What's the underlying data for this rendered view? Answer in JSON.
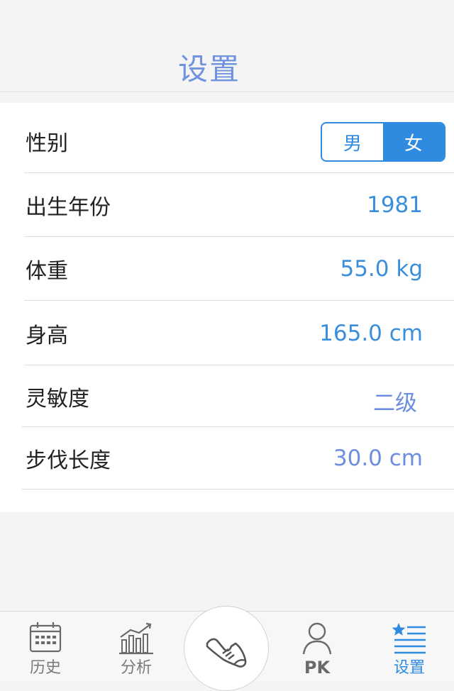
{
  "header": {
    "title": "设置"
  },
  "settings": {
    "gender": {
      "label": "性别",
      "options": [
        "男",
        "女"
      ],
      "selected": "女"
    },
    "birth_year": {
      "label": "出生年份",
      "value": "1981"
    },
    "weight": {
      "label": "体重",
      "value": "55.0 kg"
    },
    "height": {
      "label": "身高",
      "value": "165.0 cm"
    },
    "sensitivity": {
      "label": "灵敏度",
      "value": "二级"
    },
    "stride": {
      "label": "步伐长度",
      "value": "30.0 cm"
    }
  },
  "tabbar": {
    "items": [
      {
        "label": "历史",
        "icon": "calendar-icon"
      },
      {
        "label": "分析",
        "icon": "chart-icon"
      },
      {
        "label": "",
        "icon": "shoe-icon"
      },
      {
        "label": "PK",
        "icon": "user-icon"
      },
      {
        "label": "设置",
        "icon": "settings-list-icon"
      }
    ],
    "active": "设置"
  },
  "colors": {
    "accent": "#2e8be0",
    "title": "#6f93df",
    "background": "#f4f4f4"
  }
}
